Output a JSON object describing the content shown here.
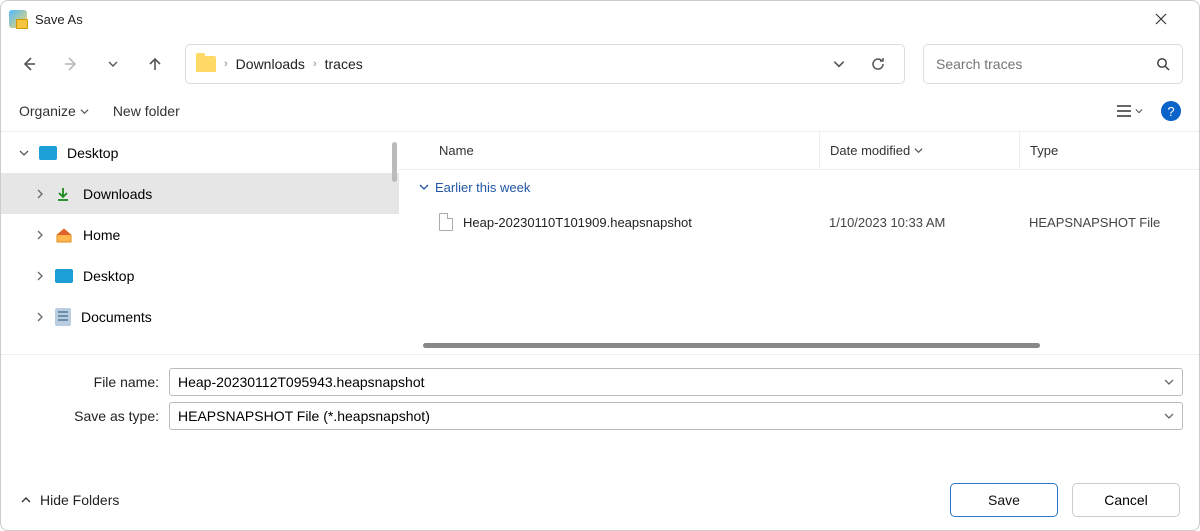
{
  "window": {
    "title": "Save As"
  },
  "nav": {
    "back_enabled": true,
    "forward_enabled": false
  },
  "breadcrumbs": [
    "Downloads",
    "traces"
  ],
  "search": {
    "placeholder": "Search traces"
  },
  "toolbar": {
    "organize": "Organize",
    "new_folder": "New folder"
  },
  "sidebar": {
    "items": [
      {
        "label": "Desktop",
        "expanded": true,
        "icon": "desktop"
      },
      {
        "label": "Downloads",
        "selected": true,
        "icon": "download"
      },
      {
        "label": "Home",
        "icon": "home"
      },
      {
        "label": "Desktop",
        "icon": "desktop"
      },
      {
        "label": "Documents",
        "icon": "docs"
      }
    ]
  },
  "columns": {
    "name": "Name",
    "date": "Date modified",
    "type": "Type"
  },
  "group_header": "Earlier this week",
  "files": [
    {
      "name": "Heap-20230110T101909.heapsnapshot",
      "date": "1/10/2023 10:33 AM",
      "type": "HEAPSNAPSHOT File"
    }
  ],
  "form": {
    "file_name_label": "File name:",
    "file_name_value": "Heap-20230112T095943.heapsnapshot",
    "save_type_label": "Save as type:",
    "save_type_value": "HEAPSNAPSHOT File (*.heapsnapshot)"
  },
  "footer": {
    "hide_folders": "Hide Folders",
    "save": "Save",
    "cancel": "Cancel"
  }
}
